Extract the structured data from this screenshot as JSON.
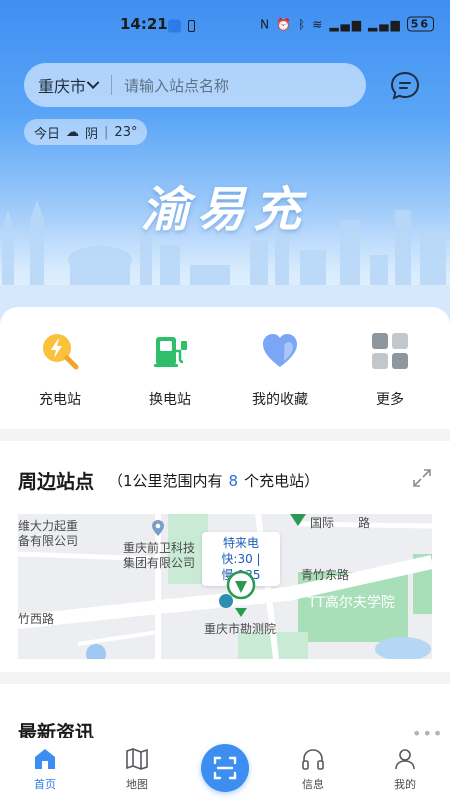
{
  "status_bar": {
    "time": "14:21",
    "battery": "56"
  },
  "header": {
    "city": "重庆市",
    "search_placeholder": "请输入站点名称",
    "weather": {
      "day": "今日",
      "condition": "阴",
      "temperature": "23°"
    },
    "brand_title": "渝易充"
  },
  "quick_actions": [
    {
      "label": "充电站",
      "icon": "charging-search-icon"
    },
    {
      "label": "换电站",
      "icon": "battery-swap-icon"
    },
    {
      "label": "我的收藏",
      "icon": "heart-icon"
    },
    {
      "label": "更多",
      "icon": "grid-icon"
    }
  ],
  "nearby": {
    "title": "周边站点",
    "subtitle_prefix": "（1公里范围内有",
    "count": "8",
    "subtitle_suffix": "个充电站）",
    "map": {
      "labels": {
        "l1": "维大力起重",
        "l2": "备有限公司",
        "l3": "重庆前卫科技",
        "l4": "集团有限公司",
        "l5": "青竹东路",
        "l6": "TT高尔夫学院",
        "l7": "竹西路",
        "l8": "重庆市勘测院",
        "l9": "国际",
        "l10": "路"
      },
      "popup": {
        "name": "特来电",
        "fast": "快:30",
        "slow": "慢:135"
      }
    }
  },
  "news": {
    "title": "最新资讯",
    "more": "•••"
  },
  "tabs": [
    {
      "label": "首页",
      "icon": "home-icon",
      "active": true
    },
    {
      "label": "地图",
      "icon": "map-icon",
      "active": false
    },
    {
      "label": "",
      "icon": "scan-icon",
      "active": false
    },
    {
      "label": "信息",
      "icon": "headset-icon",
      "active": false
    },
    {
      "label": "我的",
      "icon": "user-icon",
      "active": false
    }
  ],
  "colors": {
    "accent": "#2f7ee8",
    "brand_blue": "#3c8ef0",
    "count_blue": "#2b73d8"
  }
}
